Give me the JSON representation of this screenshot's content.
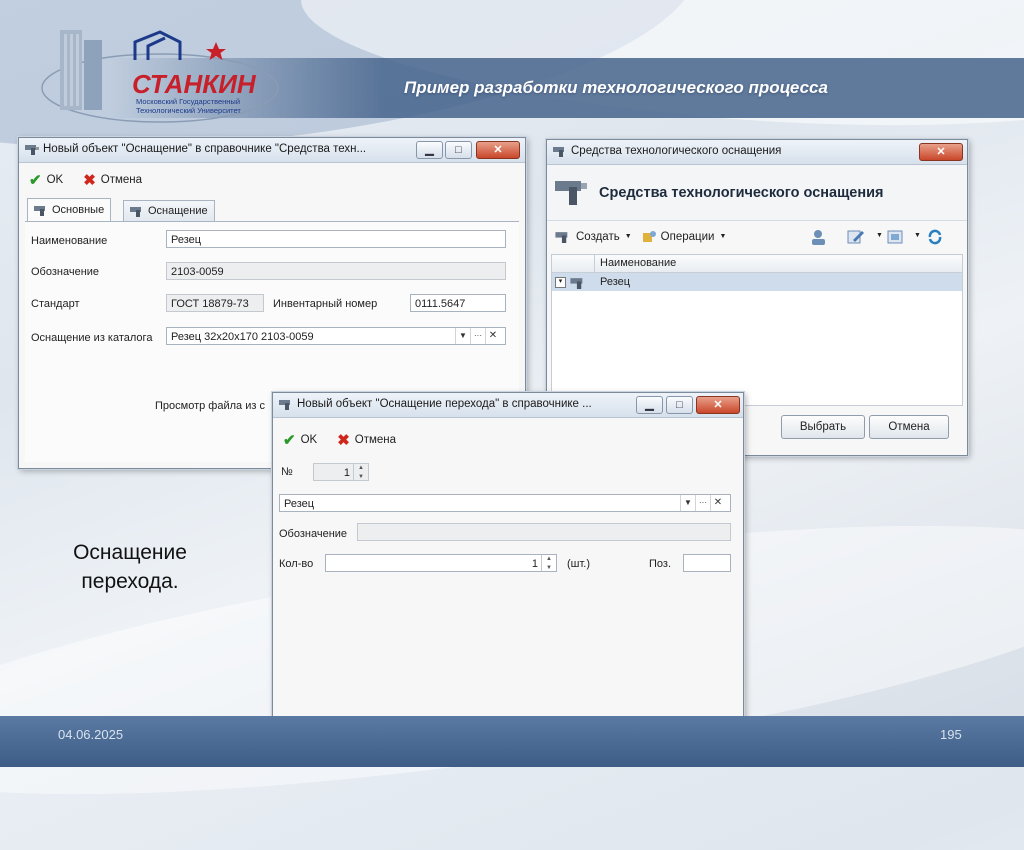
{
  "slide": {
    "title": "Пример разработки технологического процесса",
    "caption_line1": "Оснащение",
    "caption_line2": "перехода.",
    "date": "04.06.2025",
    "page": "195"
  },
  "logo": {
    "name": "СТАНКИН",
    "sub1": "Московский Государственный",
    "sub2": "Технологический Университет"
  },
  "win1": {
    "title": "Новый объект \"Оснащение\" в справочнике \"Средства техн...",
    "ok": "OK",
    "cancel": "Отмена",
    "tabs": [
      "Основные",
      "Оснащение"
    ],
    "name_label": "Наименование",
    "name_value": "Резец",
    "designation_label": "Обозначение",
    "designation_value": "2103-0059",
    "standard_label": "Стандарт",
    "standard_value": "ГОСТ 18879-73",
    "inventory_label": "Инвентарный номер",
    "inventory_value": "0111.5647",
    "catalog_label": "Оснащение из каталога",
    "catalog_value": "Резец 32x20x170 2103-0059",
    "preview_text": "Просмотр файла из с"
  },
  "win2": {
    "title": "Средства технологического оснащения",
    "heading": "Средства технологического оснащения",
    "create": "Создать",
    "operations": "Операции",
    "column": "Наименование",
    "row": "Резец",
    "select": "Выбрать",
    "cancel": "Отмена"
  },
  "win3": {
    "title": "Новый объект \"Оснащение перехода\" в справочнике ...",
    "ok": "OK",
    "cancel": "Отмена",
    "num_label": "№",
    "num_value": "1",
    "item_value": "Резец",
    "designation_label": "Обозначение",
    "qty_label": "Кол-во",
    "qty_value": "1",
    "unit": "(шт.)",
    "pos_label": "Поз."
  },
  "colors": {
    "accent": "#3d5c86",
    "close_button": "#c9472b",
    "ok_check": "#2b9a2b",
    "cancel_cross": "#d0271c",
    "selected_row": "#cfdcec"
  }
}
